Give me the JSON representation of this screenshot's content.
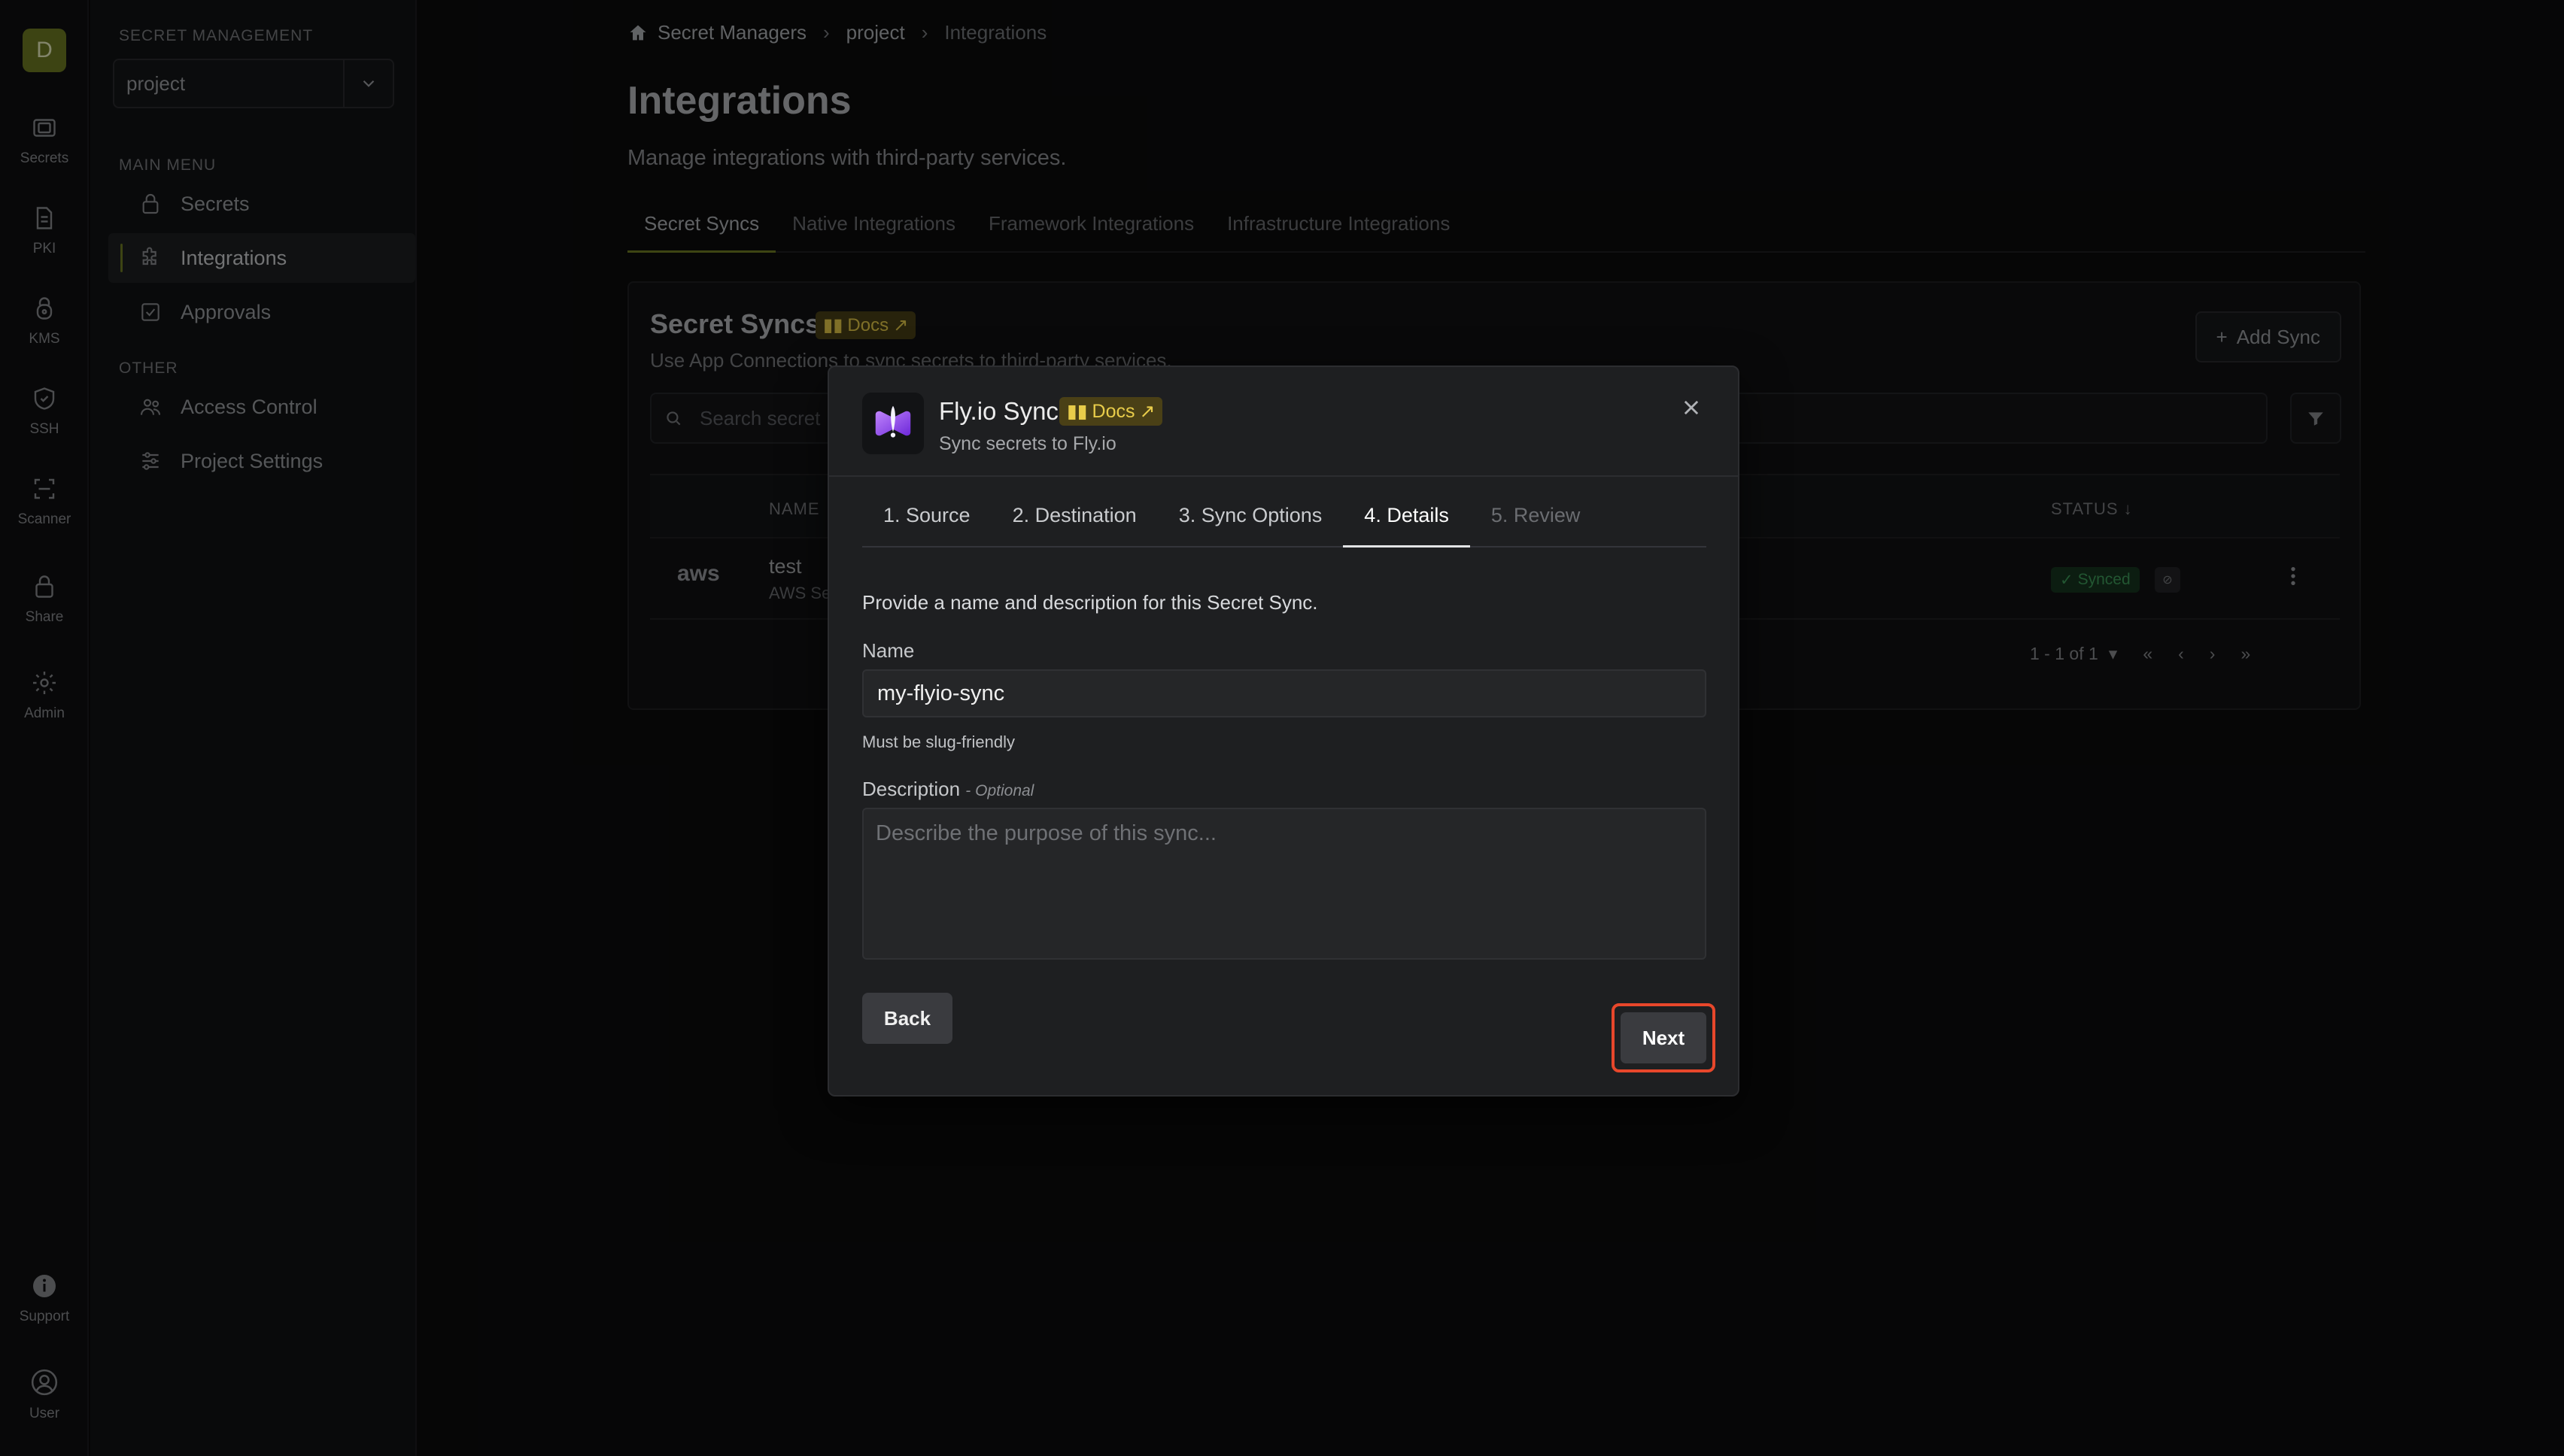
{
  "rail": {
    "org_initial": "D",
    "items": [
      {
        "label": "Secrets",
        "icon": "vault-icon"
      },
      {
        "label": "PKI",
        "icon": "document-icon"
      },
      {
        "label": "KMS",
        "icon": "key-lock-icon"
      },
      {
        "label": "SSH",
        "icon": "shield-icon"
      },
      {
        "label": "Scanner",
        "icon": "scan-icon"
      },
      {
        "label": "Share",
        "icon": "lock-icon"
      },
      {
        "label": "Admin",
        "icon": "gear-icon"
      },
      {
        "label": "Support",
        "icon": "info-icon"
      },
      {
        "label": "User",
        "icon": "user-icon"
      }
    ]
  },
  "sidebar": {
    "section_title": "SECRET MANAGEMENT",
    "project_value": "project",
    "main_menu_title": "MAIN MENU",
    "main_items": [
      {
        "label": "Secrets",
        "icon": "lock-icon"
      },
      {
        "label": "Integrations",
        "icon": "puzzle-icon"
      },
      {
        "label": "Approvals",
        "icon": "checkbox-icon"
      }
    ],
    "other_title": "OTHER",
    "other_items": [
      {
        "label": "Access Control",
        "icon": "users-icon"
      },
      {
        "label": "Project Settings",
        "icon": "sliders-icon"
      }
    ]
  },
  "breadcrumb": {
    "home": "Secret Managers",
    "project": "project",
    "current": "Integrations"
  },
  "page": {
    "title": "Integrations",
    "subtitle": "Manage integrations with third-party services.",
    "tabs": [
      "Secret Syncs",
      "Native Integrations",
      "Framework Integrations",
      "Infrastructure Integrations"
    ]
  },
  "sync_card": {
    "title": "Secret Syncs",
    "docs_label": "Docs",
    "subtitle": "Use App Connections to sync secrets to third-party services.",
    "add_label": "Add Sync",
    "search_placeholder": "Search secret",
    "col_name": "NAME",
    "col_status": "STATUS",
    "row": {
      "logo": "aws",
      "name": "test",
      "sub": "AWS Se",
      "status": "Synced"
    },
    "pagination": "1 - 1 of 1"
  },
  "modal": {
    "title": "Fly.io Sync",
    "docs_label": "Docs",
    "subtitle": "Sync secrets to Fly.io",
    "steps": [
      "1. Source",
      "2. Destination",
      "3. Sync Options",
      "4. Details",
      "5. Review"
    ],
    "active_step": 3,
    "intro": "Provide a name and description for this Secret Sync.",
    "name_label": "Name",
    "name_value": "my-flyio-sync",
    "name_helper": "Must be slug-friendly",
    "description_label": "Description",
    "description_optional": "- Optional",
    "description_placeholder": "Describe the purpose of this sync...",
    "back_label": "Back",
    "next_label": "Next"
  },
  "colors": {
    "accent": "#6f7d24",
    "highlight": "#e8472b",
    "docs_badge_bg": "#4a4016",
    "docs_badge_text": "#e8cc4a",
    "synced": "#3f9d5b"
  }
}
